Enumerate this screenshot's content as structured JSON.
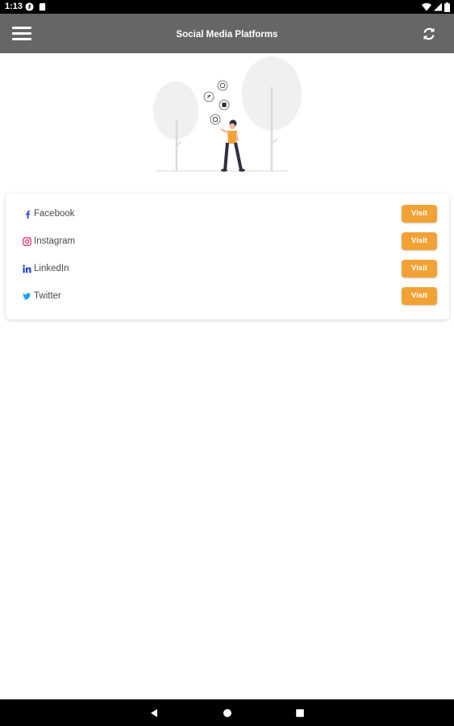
{
  "status_bar": {
    "time": "1:13",
    "icons": [
      "notification-f-icon",
      "sd-card-icon",
      "wifi-icon",
      "cell-signal-icon",
      "battery-icon"
    ]
  },
  "app_bar": {
    "title": "Social Media Platforms",
    "left_icon": "menu-icon",
    "right_icon": "refresh-icon",
    "background": "#666666"
  },
  "platforms": [
    {
      "name": "Facebook",
      "icon": "facebook-icon",
      "icon_color": "#1a3fd6",
      "button": "Visit"
    },
    {
      "name": "Instagram",
      "icon": "instagram-icon",
      "icon_color": "#e1306c",
      "button": "Visit"
    },
    {
      "name": "LinkedIn",
      "icon": "linkedin-icon",
      "icon_color": "#1a3fd6",
      "button": "Visit"
    },
    {
      "name": "Twitter",
      "icon": "twitter-icon",
      "icon_color": "#1da1f2",
      "button": "Visit"
    }
  ],
  "colors": {
    "accent": "#f2a234",
    "app_bar": "#666666"
  },
  "nav_bar": {
    "buttons": [
      "back-icon",
      "home-icon",
      "recents-icon"
    ]
  }
}
